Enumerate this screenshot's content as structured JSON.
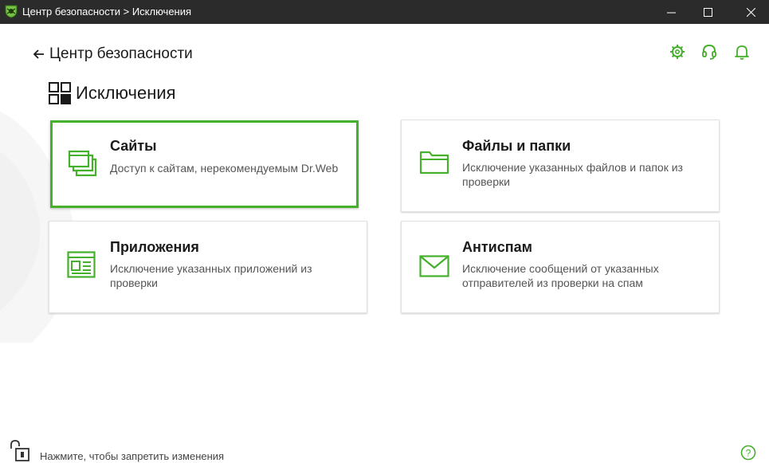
{
  "window": {
    "title": "Центр безопасности > Исключения",
    "accent": "#44b02b",
    "titlebar_bg": "#2b2b2b"
  },
  "header": {
    "back_label": "Центр безопасности",
    "icons": [
      "gear-icon",
      "headset-icon",
      "bell-icon"
    ]
  },
  "page": {
    "title": "Исключения",
    "icon": "grid-icon"
  },
  "cards": [
    {
      "title": "Сайты",
      "description": "Доступ к сайтам, нерекомендуемым Dr.Web",
      "icon": "browser-windows-icon",
      "selected": true
    },
    {
      "title": "Файлы и папки",
      "description": "Исключение указанных файлов и папок из проверки",
      "icon": "folder-icon",
      "selected": false
    },
    {
      "title": "Приложения",
      "description": "Исключение указанных приложений из проверки",
      "icon": "app-window-icon",
      "selected": false
    },
    {
      "title": "Антиспам",
      "description": "Исключение сообщений от указанных отправителей из проверки на спам",
      "icon": "envelope-icon",
      "selected": false
    }
  ],
  "footer": {
    "lock_text": "Нажмите, чтобы запретить изменения",
    "lock_icon": "unlocked-padlock-icon",
    "help_icon": "help-icon"
  }
}
